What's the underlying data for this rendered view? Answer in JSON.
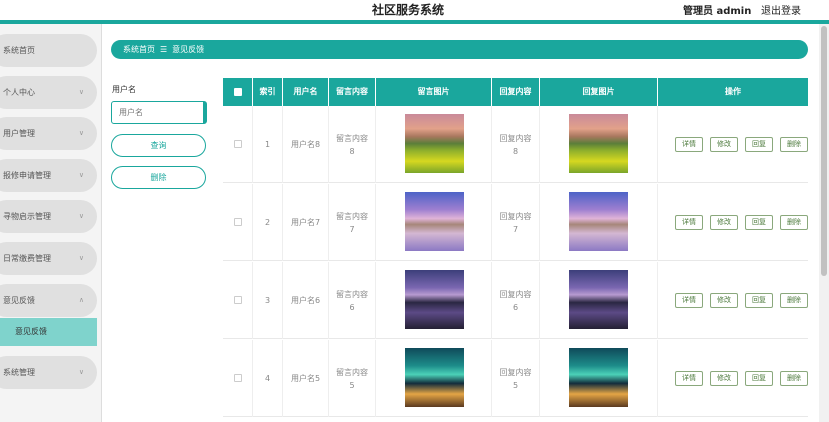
{
  "header": {
    "title": "社区服务系统",
    "admin": "管理员 admin",
    "logout": "退出登录"
  },
  "sidebar": {
    "items": [
      {
        "label": "系统首页",
        "chevron": false
      },
      {
        "label": "个人中心",
        "chevron": true
      },
      {
        "label": "用户管理",
        "chevron": true
      },
      {
        "label": "报修申请管理",
        "chevron": true
      },
      {
        "label": "寻物启示管理",
        "chevron": true
      },
      {
        "label": "日常缴费管理",
        "chevron": true
      },
      {
        "label": "意见反馈",
        "chevron": true,
        "expanded": true
      },
      {
        "label": "系统管理",
        "chevron": true
      }
    ],
    "subitem": "意见反馈",
    "chevron_glyph": "∨",
    "chevron_up_glyph": "∧"
  },
  "breadcrumb": {
    "home": "系统首页",
    "separator": "☰",
    "current": "意见反馈"
  },
  "search": {
    "label": "用户名",
    "placeholder": "用户名",
    "query_button": "查询",
    "delete_button": "删除"
  },
  "table": {
    "columns": [
      "索引",
      "用户名",
      "留言内容",
      "留言图片",
      "回复内容",
      "回复图片",
      "操作"
    ],
    "rows": [
      {
        "index": "1",
        "username": "用户名8",
        "message_line1": "留言内容",
        "message_line2": "8",
        "reply_line1": "回复内容",
        "reply_line2": "8",
        "image": "meadow-mountain-photo"
      },
      {
        "index": "2",
        "username": "用户名7",
        "message_line1": "留言内容",
        "message_line2": "7",
        "reply_line1": "回复内容",
        "reply_line2": "7",
        "image": "lake-mountain-photo"
      },
      {
        "index": "3",
        "username": "用户名6",
        "message_line1": "留言内容",
        "message_line2": "6",
        "reply_line1": "回复内容",
        "reply_line2": "6",
        "image": "iceland-mountain-photo"
      },
      {
        "index": "4",
        "username": "用户名5",
        "message_line1": "留言内容",
        "message_line2": "5",
        "reply_line1": "回复内容",
        "reply_line2": "5",
        "image": "aurora-cabin-photo"
      }
    ],
    "actions": [
      "详情",
      "修改",
      "回复",
      "删除"
    ]
  },
  "colors": {
    "accent": "#1aa79d",
    "sidebar_active": "#7fd3cc",
    "action_border": "#8aa87c"
  }
}
